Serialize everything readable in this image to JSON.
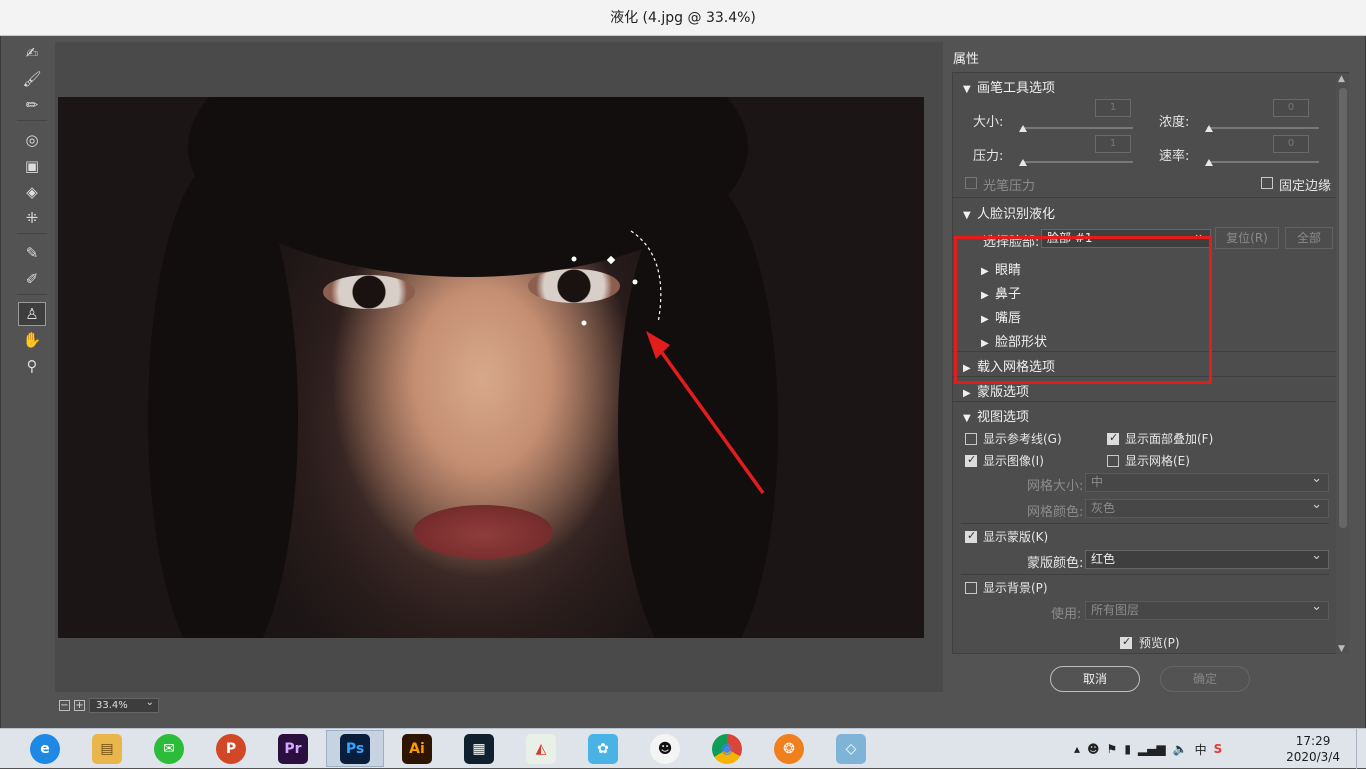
{
  "window": {
    "title": "液化 (4.jpg @ 33.4%)"
  },
  "toolbar": {
    "tools": [
      {
        "name": "forward-warp-tool-icon",
        "glyph": "✍"
      },
      {
        "name": "reconstruct-tool-icon",
        "glyph": "🖌"
      },
      {
        "name": "smooth-tool-icon",
        "glyph": "🖌"
      },
      {
        "name": "twirl-tool-icon",
        "glyph": "◎"
      },
      {
        "name": "pucker-tool-icon",
        "glyph": "▣"
      },
      {
        "name": "bloat-tool-icon",
        "glyph": "◈"
      },
      {
        "name": "push-left-tool-icon",
        "glyph": "⁜"
      },
      {
        "name": "freeze-mask-tool-icon",
        "glyph": "✎"
      },
      {
        "name": "thaw-mask-tool-icon",
        "glyph": "✐"
      },
      {
        "name": "face-tool-icon",
        "glyph": "♙"
      },
      {
        "name": "hand-tool-icon",
        "glyph": "✋"
      },
      {
        "name": "zoom-tool-icon",
        "glyph": "⚲"
      }
    ]
  },
  "canvas": {
    "zoom_value": "33.4%"
  },
  "properties": {
    "header": "属性",
    "brush_section": {
      "title": "画笔工具选项",
      "size_label": "大小:",
      "size_value": "1",
      "density_label": "浓度:",
      "density_value": "0",
      "pressure_label": "压力:",
      "pressure_value": "1",
      "rate_label": "速率:",
      "rate_value": "0",
      "stylus_pressure": "光笔压力",
      "pin_edges": "固定边缘"
    },
    "face_section": {
      "title": "人脸识别液化",
      "select_face_label": "选择脸部:",
      "select_face_value": "脸部 #1",
      "reset_button": "复位(R)",
      "all_button": "全部",
      "items": [
        "眼睛",
        "鼻子",
        "嘴唇",
        "脸部形状"
      ]
    },
    "load_mesh": "载入网格选项",
    "mask_options": "蒙版选项",
    "view_section": {
      "title": "视图选项",
      "show_guides": "显示参考线(G)",
      "show_face_overlay": "显示面部叠加(F)",
      "show_image": "显示图像(I)",
      "show_mesh": "显示网格(E)",
      "mesh_size_label": "网格大小:",
      "mesh_size_value": "中",
      "mesh_color_label": "网格颜色:",
      "mesh_color_value": "灰色",
      "show_mask": "显示蒙版(K)",
      "mask_color_label": "蒙版颜色:",
      "mask_color_value": "红色",
      "show_backdrop": "显示背景(P)",
      "use_label": "使用:",
      "use_value": "所有图层"
    },
    "preview": "预览(P)",
    "cancel": "取消",
    "ok": "确定"
  },
  "taskbar": {
    "apps": [
      {
        "name": "ie-browser-icon",
        "glyph": "e",
        "color": "#1e88e5"
      },
      {
        "name": "file-explorer-icon",
        "glyph": "▤",
        "color": "#e8b64a"
      },
      {
        "name": "wechat-icon",
        "glyph": "✉",
        "color": "#2dbb3a"
      },
      {
        "name": "powerpoint-icon",
        "glyph": "P",
        "color": "#d24726"
      },
      {
        "name": "premiere-icon",
        "glyph": "Pr",
        "color": "#2a0f3f"
      },
      {
        "name": "photoshop-icon",
        "glyph": "Ps",
        "color": "#0a1d3a"
      },
      {
        "name": "illustrator-icon",
        "glyph": "Ai",
        "color": "#2e1500"
      },
      {
        "name": "video-editor-icon",
        "glyph": "▦",
        "color": "#10202e"
      },
      {
        "name": "screenshot-tool-icon",
        "glyph": "◭",
        "color": "#e8f0e8"
      },
      {
        "name": "qq-assistant-icon",
        "glyph": "✿",
        "color": "#4ab3e6"
      },
      {
        "name": "qq-icon",
        "glyph": "☻",
        "color": "#111111"
      },
      {
        "name": "chrome-icon",
        "glyph": "◉",
        "color": "#db4437"
      },
      {
        "name": "media-player-icon",
        "glyph": "❂",
        "color": "#f07f1e"
      },
      {
        "name": "notepad-icon",
        "glyph": "◇",
        "color": "#7fb4d6"
      }
    ],
    "tray_lang": "中",
    "time": "17:29",
    "date": "2020/3/4"
  },
  "colors": {
    "highlight": "#e31c1c",
    "panel_bg": "#4d4d4d",
    "workspace_bg": "#535353"
  }
}
